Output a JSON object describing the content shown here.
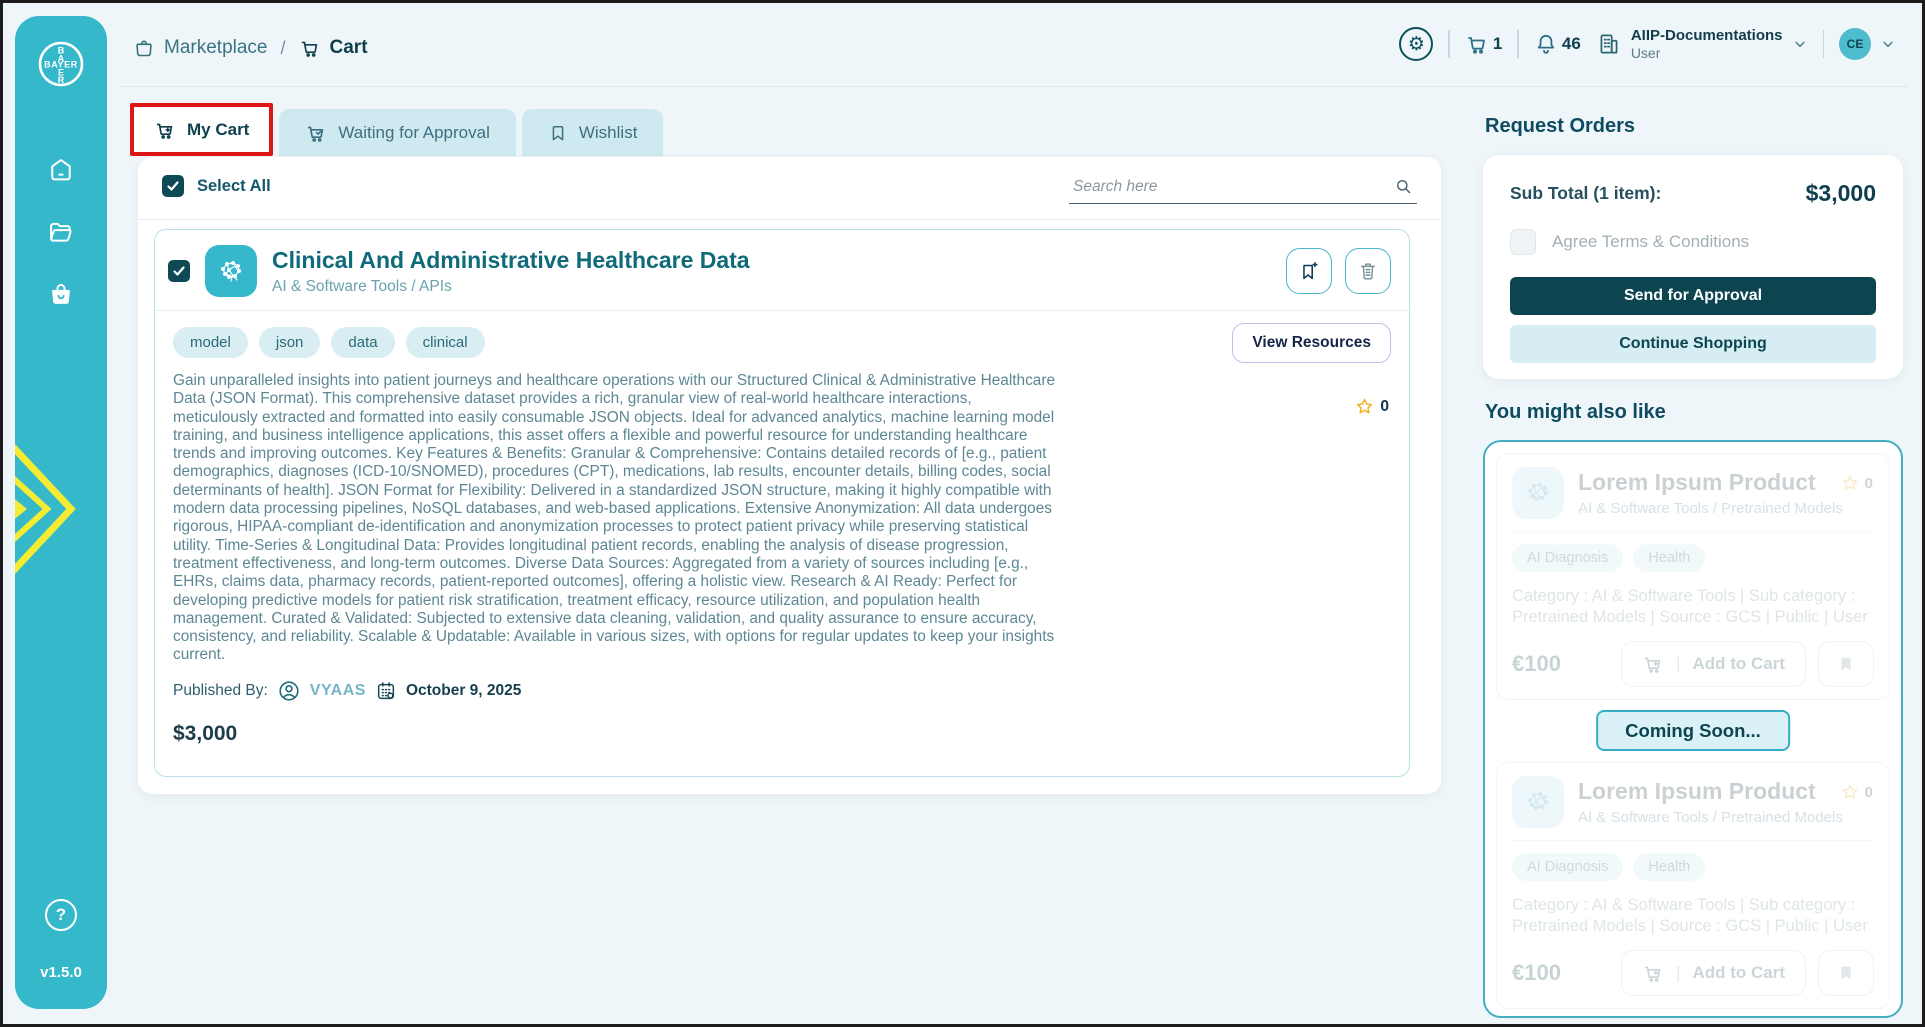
{
  "app": {
    "brand": "BAYER",
    "version": "v1.5.0"
  },
  "breadcrumb": {
    "root": "Marketplace",
    "separator": "/",
    "current": "Cart"
  },
  "header": {
    "cart_count": "1",
    "notification_count": "46",
    "account_name": "AIIP-Documentations",
    "account_role": "User",
    "avatar_initials": "CE"
  },
  "tabs": [
    {
      "label": "My Cart"
    },
    {
      "label": "Waiting for Approval"
    },
    {
      "label": "Wishlist"
    }
  ],
  "cart": {
    "select_all_label": "Select All",
    "search_placeholder": "Search here",
    "item": {
      "title": "Clinical And Administrative Healthcare Data",
      "category": "AI & Software Tools / APIs",
      "tags": [
        "model",
        "json",
        "data",
        "clinical"
      ],
      "view_resources_label": "View Resources",
      "rating": "0",
      "description": "Gain unparalleled insights into patient journeys and healthcare operations with our Structured Clinical & Administrative Healthcare Data (JSON Format). This comprehensive dataset provides a rich, granular view of real-world healthcare interactions, meticulously extracted and formatted into easily consumable JSON objects. Ideal for advanced analytics, machine learning model training, and business intelligence applications, this asset offers a flexible and powerful resource for understanding healthcare trends and improving outcomes. Key Features & Benefits: Granular & Comprehensive: Contains detailed records of [e.g., patient demographics, diagnoses (ICD-10/SNOMED), procedures (CPT), medications, lab results, encounter details, billing codes, social determinants of health]. JSON Format for Flexibility: Delivered in a standardized JSON structure, making it highly compatible with modern data processing pipelines, NoSQL databases, and web-based applications. Extensive Anonymization: All data undergoes rigorous, HIPAA-compliant de-identification and anonymization processes to protect patient privacy while preserving statistical utility. Time-Series & Longitudinal Data: Provides longitudinal patient records, enabling the analysis of disease progression, treatment effectiveness, and long-term outcomes. Diverse Data Sources: Aggregated from a variety of sources including [e.g., EHRs, claims data, pharmacy records, patient-reported outcomes], offering a holistic view. Research & AI Ready: Perfect for developing predictive models for patient risk stratification, treatment efficacy, resource utilization, and population health management. Curated & Validated: Subjected to extensive data cleaning, validation, and quality assurance to ensure accuracy, consistency, and reliability. Scalable & Updatable: Available in various sizes, with options for regular updates to keep your insights current.",
      "published_by_label": "Published By:",
      "publisher": "VYAAS",
      "published_date": "October 9, 2025",
      "price": "$3,000"
    }
  },
  "request_orders": {
    "title": "Request Orders",
    "subtotal_label": "Sub Total (1 item):",
    "subtotal_value": "$3,000",
    "terms_label": "Agree Terms & Conditions",
    "send_button": "Send for Approval",
    "continue_button": "Continue Shopping"
  },
  "suggestions": {
    "title": "You might also like",
    "coming_soon_label": "Coming Soon...",
    "add_to_cart_divider": "|",
    "products": [
      {
        "title": "Lorem Ipsum Product",
        "category": "AI & Software Tools / Pretrained Models",
        "rating": "0",
        "tags": [
          "AI Diagnosis",
          "Health"
        ],
        "meta": "Category : AI & Software Tools | Sub category : Pretrained Models | Source : GCS | Public | User",
        "price": "€100",
        "add_to_cart_label": "Add to Cart"
      },
      {
        "title": "Lorem Ipsum Product",
        "category": "AI & Software Tools / Pretrained Models",
        "rating": "0",
        "tags": [
          "AI Diagnosis",
          "Health"
        ],
        "meta": "Category : AI & Software Tools | Sub category : Pretrained Models | Source : GCS | Public | User",
        "price": "€100",
        "add_to_cart_label": "Add to Cart"
      }
    ]
  },
  "colors": {
    "sidebar_teal": "#34b8ca",
    "dark_teal": "#0c4550",
    "annotation_red": "#e01515",
    "star_gold": "#edb41f",
    "tag_bg": "#d9eef3",
    "tab_bg": "#cfe9f0"
  }
}
